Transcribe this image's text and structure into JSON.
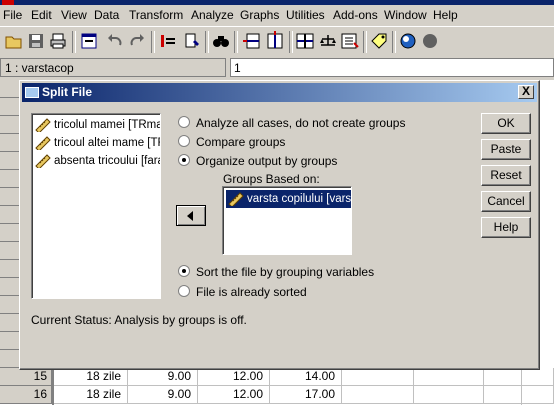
{
  "menubar": {
    "items": [
      "File",
      "Edit",
      "View",
      "Data",
      "Transform",
      "Analyze",
      "Graphs",
      "Utilities",
      "Add-ons",
      "Window",
      "Help"
    ]
  },
  "cellbar": {
    "cell_ref": "1 : varstacop",
    "cell_value": "1"
  },
  "grid": {
    "rows": [
      {
        "num": "15",
        "c1": "18 zile",
        "c2": "9.00",
        "c3": "12.00",
        "c4": "14.00"
      },
      {
        "num": "16",
        "c1": "18 zile",
        "c2": "9.00",
        "c3": "12.00",
        "c4": "17.00"
      }
    ]
  },
  "dialog": {
    "title": "Split File",
    "close_label": "X",
    "variables": [
      "tricolul mamei [TRmamei]",
      "tricoul altei mame [TRaltei]",
      "absenta tricoului [faraT]"
    ],
    "radio_analyze_all": "Analyze all cases, do not create groups",
    "radio_compare": "Compare groups",
    "radio_organize": "Organize output by groups",
    "groups_label": "Groups Based on:",
    "groups_items": [
      "varsta copilului [varsta]"
    ],
    "radio_sort": "Sort the file by grouping variables",
    "radio_sorted": "File is already sorted",
    "status_text": "Current Status:  Analysis by groups is off.",
    "buttons": {
      "ok": "OK",
      "paste": "Paste",
      "reset": "Reset",
      "cancel": "Cancel",
      "help": "Help"
    },
    "selected_mode": "organize",
    "selected_sort": "sort"
  },
  "colors": {
    "title_start": "#0a246a",
    "title_end": "#a6caf0",
    "face": "#d4d0c8",
    "selection": "#0a246a"
  }
}
